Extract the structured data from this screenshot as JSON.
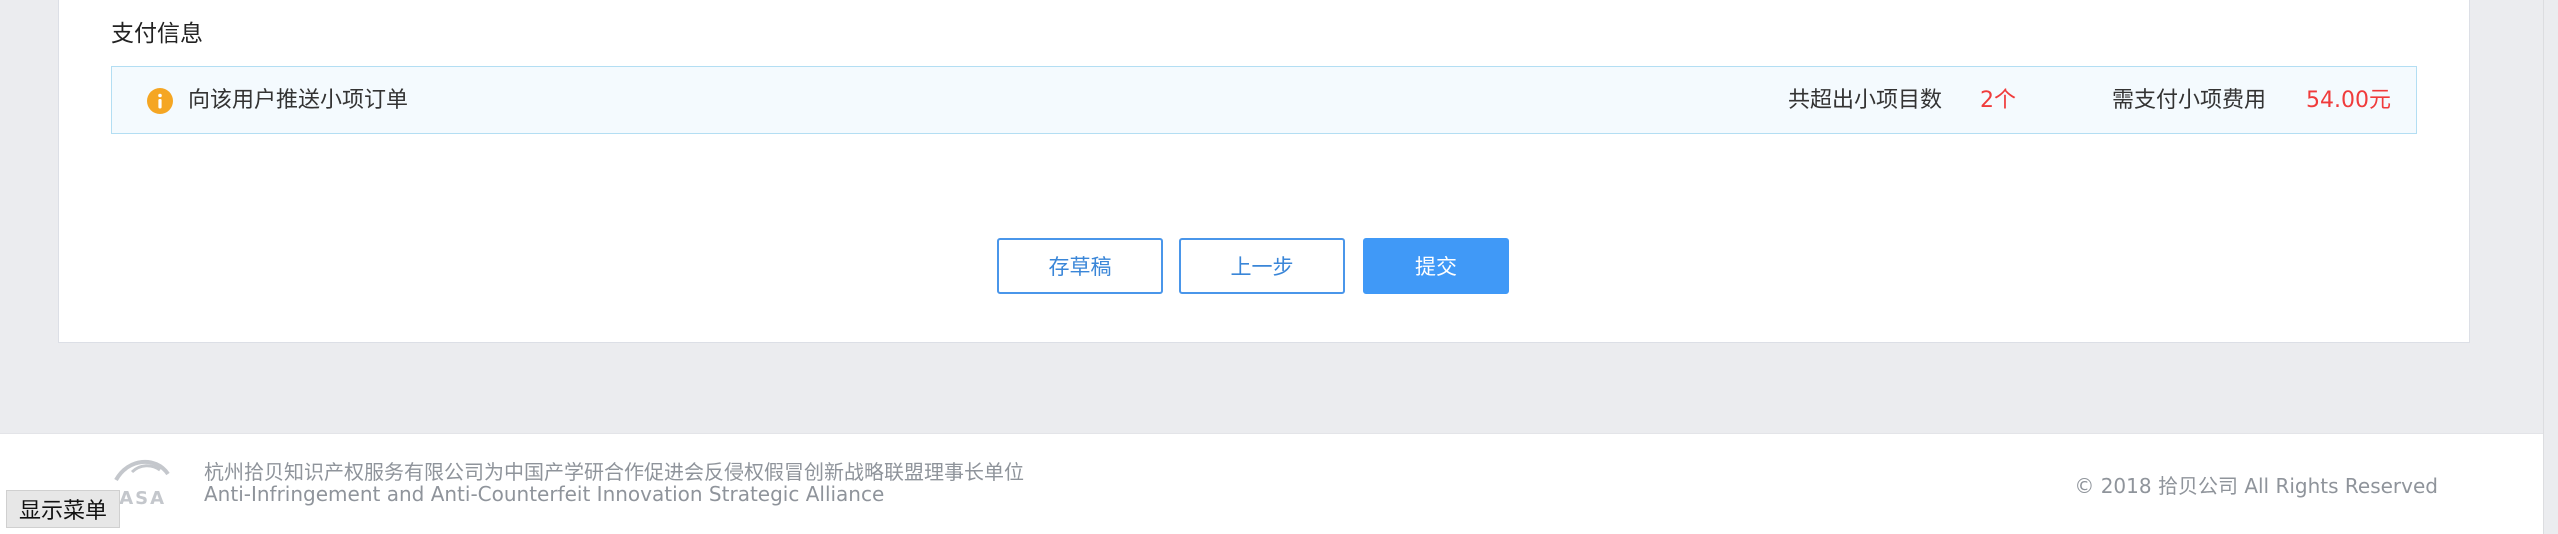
{
  "payment": {
    "section_title": "支付信息",
    "notice_text": "向该用户推送小项订单",
    "exceed_label": "共超出小项目数",
    "exceed_value": "2个",
    "fee_label": "需支付小项费用",
    "fee_value": "54.00元",
    "icon": "info-icon",
    "accent_color": "#f5a623",
    "value_color": "#f03b3b"
  },
  "actions": {
    "save_draft": "存草稿",
    "previous_step": "上一步",
    "submit": "提交"
  },
  "footer": {
    "line_cn": "杭州拾贝知识产权服务有限公司为中国产学研合作促进会反侵权假冒创新战略联盟理事长单位",
    "line_en": "Anti-Infringement and Anti-Counterfeit Innovation Strategic Alliance",
    "copyright": "© 2018 拾贝公司 All Rights Reserved",
    "logo_text": "CASA"
  },
  "menu_toggle": "显示菜单"
}
